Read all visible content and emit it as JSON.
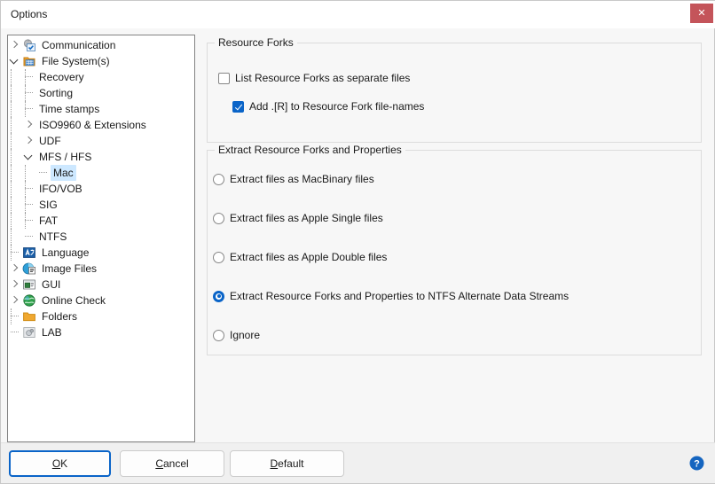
{
  "window": {
    "title": "Options",
    "close_label": "✕"
  },
  "tree": {
    "items": [
      {
        "label": "Communication",
        "depth": 0,
        "state": "collapsed",
        "icon": "communication-gear-icon",
        "selected": false
      },
      {
        "label": "File System(s)",
        "depth": 0,
        "state": "expanded",
        "icon": "file-system-icon",
        "selected": false
      },
      {
        "label": "Recovery",
        "depth": 1,
        "state": "leaf",
        "icon": "none",
        "selected": false
      },
      {
        "label": "Sorting",
        "depth": 1,
        "state": "leaf",
        "icon": "none",
        "selected": false
      },
      {
        "label": "Time stamps",
        "depth": 1,
        "state": "leaf",
        "icon": "none",
        "selected": false
      },
      {
        "label": "ISO9960 & Extensions",
        "depth": 1,
        "state": "collapsed",
        "icon": "none",
        "selected": false
      },
      {
        "label": "UDF",
        "depth": 1,
        "state": "collapsed",
        "icon": "none",
        "selected": false
      },
      {
        "label": "MFS / HFS",
        "depth": 1,
        "state": "expanded",
        "icon": "none",
        "selected": false
      },
      {
        "label": "Mac",
        "depth": 2,
        "state": "leaf",
        "icon": "none",
        "selected": true
      },
      {
        "label": "IFO/VOB",
        "depth": 1,
        "state": "leaf",
        "icon": "none",
        "selected": false
      },
      {
        "label": "SIG",
        "depth": 1,
        "state": "leaf",
        "icon": "none",
        "selected": false
      },
      {
        "label": "FAT",
        "depth": 1,
        "state": "leaf",
        "icon": "none",
        "selected": false
      },
      {
        "label": "NTFS",
        "depth": 1,
        "state": "leaf",
        "icon": "none",
        "selected": false
      },
      {
        "label": "Language",
        "depth": 0,
        "state": "leaf",
        "icon": "language-icon",
        "selected": false
      },
      {
        "label": "Image Files",
        "depth": 0,
        "state": "collapsed",
        "icon": "image-files-icon",
        "selected": false
      },
      {
        "label": "GUI",
        "depth": 0,
        "state": "collapsed",
        "icon": "gui-window-icon",
        "selected": false
      },
      {
        "label": "Online Check",
        "depth": 0,
        "state": "collapsed",
        "icon": "globe-icon",
        "selected": false
      },
      {
        "label": "Folders",
        "depth": 0,
        "state": "leaf",
        "icon": "folder-icon",
        "selected": false
      },
      {
        "label": "LAB",
        "depth": 0,
        "state": "leaf",
        "icon": "lab-icon",
        "selected": false
      }
    ]
  },
  "resource_forks_group": {
    "title": "Resource Forks",
    "options": [
      {
        "label": "List Resource Forks as separate files",
        "checked": false
      },
      {
        "label": "Add .[R] to Resource Fork file-names",
        "checked": true
      }
    ]
  },
  "extract_group": {
    "title": "Extract Resource Forks and Properties",
    "options": [
      {
        "label": "Extract files as MacBinary files",
        "selected": false
      },
      {
        "label": "Extract files as Apple Single files",
        "selected": false
      },
      {
        "label": "Extract files as Apple Double files",
        "selected": false
      },
      {
        "label": "Extract Resource Forks and Properties to NTFS Alternate Data Streams",
        "selected": true
      },
      {
        "label": "Ignore",
        "selected": false
      }
    ]
  },
  "footer": {
    "ok": {
      "accel": "O",
      "rest": "K"
    },
    "cancel": {
      "accel": "C",
      "rest": "ancel"
    },
    "default": {
      "accel": "D",
      "rest": "efault"
    },
    "help_label": "?"
  },
  "colors": {
    "accent": "#0a64c8",
    "selection": "#cde8ff",
    "close_red": "#c4545a",
    "dialog_bg": "#f7f7f7"
  }
}
